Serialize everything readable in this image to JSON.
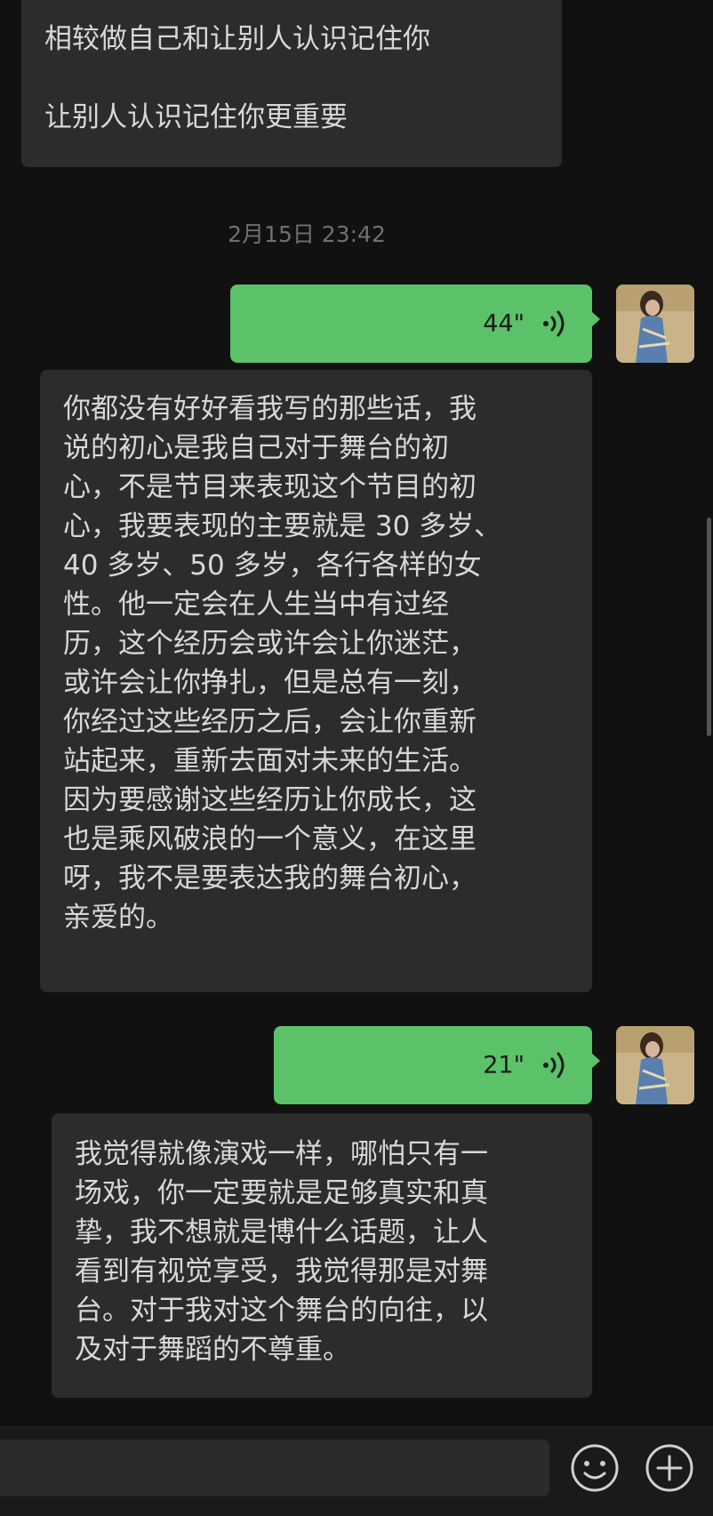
{
  "messages": [
    {
      "kind": "incoming",
      "text": "相较做自己和让别人认识记住你\n\n让别人认识记住你更重要"
    },
    {
      "kind": "timestamp",
      "text": "2月15日 23:42"
    },
    {
      "kind": "voice-outgoing",
      "duration": "44\""
    },
    {
      "kind": "incoming",
      "text": "你都没有好好看我写的那些话，我\n说的初心是我自己对于舞台的初\n心，不是节目来表现这个节目的初\n心，我要表现的主要就是 30 多岁、\n40 多岁、50 多岁，各行各样的女\n性。他一定会在人生当中有过经\n历，这个经历会或许会让你迷茫，\n或许会让你挣扎，但是总有一刻，\n你经过这些经历之后，会让你重新\n站起来，重新去面对未来的生活。\n因为要感谢这些经历让你成长，这\n也是乘风破浪的一个意义，在这里\n呀，我不是要表达我的舞台初心，\n亲爱的。"
    },
    {
      "kind": "voice-outgoing",
      "duration": "21\""
    },
    {
      "kind": "incoming",
      "text": "我觉得就像演戏一样，哪怕只有一\n场戏，你一定要就是足够真实和真\n挚，我不想就是博什么话题，让人\n看到有视觉享受，我觉得那是对舞\n台。对于我对这个舞台的向往，以\n及对于舞蹈的不尊重。"
    }
  ],
  "input_bar": {
    "text_value": "",
    "emoji_icon": "emoji-icon",
    "plus_icon": "plus-icon"
  },
  "colors": {
    "background": "#111111",
    "incoming_bubble": "#2c2c2c",
    "outgoing_bubble": "#5bc26a",
    "timestamp": "#707070"
  }
}
